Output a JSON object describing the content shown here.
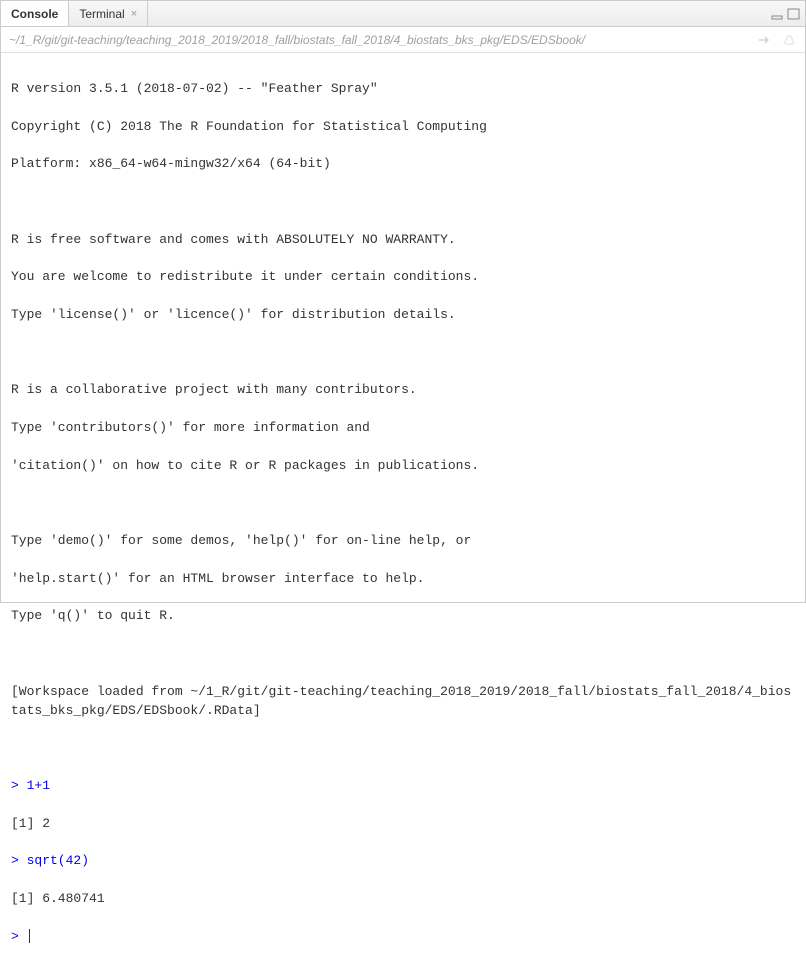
{
  "tabs": {
    "console": "Console",
    "terminal": "Terminal"
  },
  "path": "~/1_R/git/git-teaching/teaching_2018_2019/2018_fall/biostats_fall_2018/4_biostats_bks_pkg/EDS/EDSbook/",
  "console": {
    "banner1": "R version 3.5.1 (2018-07-02) -- \"Feather Spray\"",
    "banner2": "Copyright (C) 2018 The R Foundation for Statistical Computing",
    "banner3": "Platform: x86_64-w64-mingw32/x64 (64-bit)",
    "free1": "R is free software and comes with ABSOLUTELY NO WARRANTY.",
    "free2": "You are welcome to redistribute it under certain conditions.",
    "free3": "Type 'license()' or 'licence()' for distribution details.",
    "collab1": "R is a collaborative project with many contributors.",
    "collab2": "Type 'contributors()' for more information and",
    "collab3": "'citation()' on how to cite R or R packages in publications.",
    "demo1": "Type 'demo()' for some demos, 'help()' for on-line help, or",
    "demo2": "'help.start()' for an HTML browser interface to help.",
    "demo3": "Type 'q()' to quit R.",
    "workspace": "[Workspace loaded from ~/1_R/git/git-teaching/teaching_2018_2019/2018_fall/biostats_fall_2018/4_biostats_bks_pkg/EDS/EDSbook/.RData]",
    "input1": "> 1+1",
    "output1": "[1] 2",
    "input2": "> sqrt(42)",
    "output2": "[1] 6.480741",
    "prompt": "> "
  }
}
